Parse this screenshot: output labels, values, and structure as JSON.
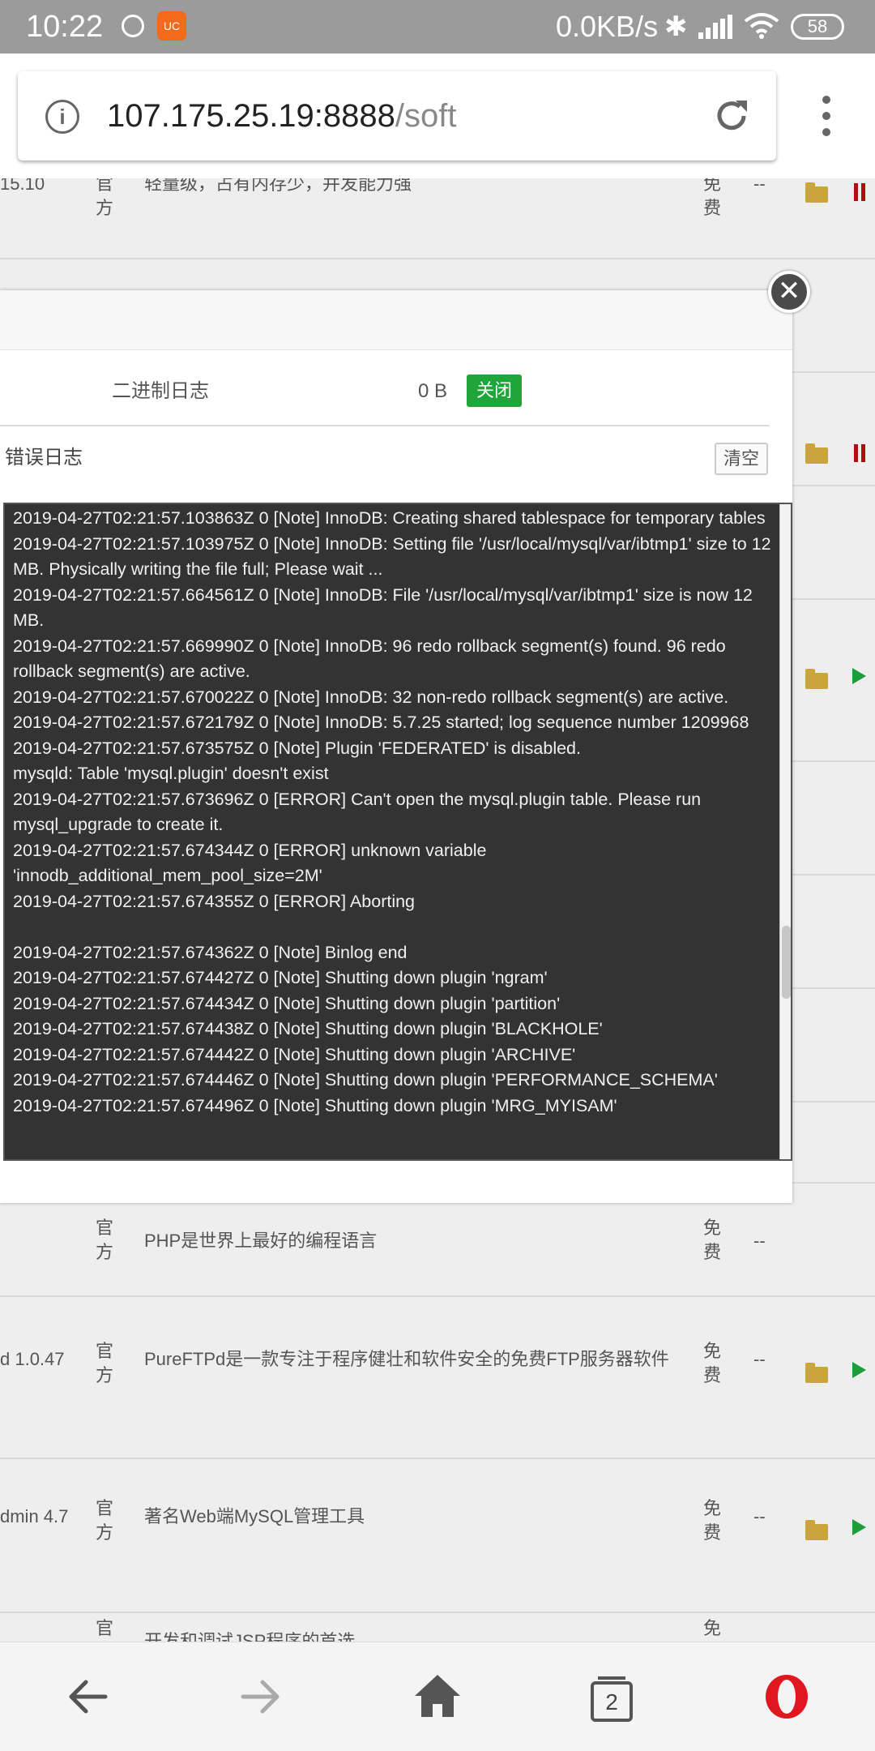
{
  "status_bar": {
    "time": "10:22",
    "net_speed": "0.0KB/s",
    "bluetooth": "✱",
    "battery": "58",
    "app_badge": "UC"
  },
  "browser": {
    "url_host": "107.175.25.19:8888",
    "url_path": "/soft"
  },
  "software_rows": [
    {
      "name": "15.10",
      "type": "官方",
      "desc": "轻量级，占有内存少，并发能力强",
      "price": "免费",
      "expire": "--",
      "status": "pause"
    },
    {
      "name": "",
      "type": "官",
      "desc": "",
      "price": "免",
      "expire": "",
      "status": "none"
    },
    {
      "name": "",
      "type": "",
      "desc": "",
      "price": "",
      "expire": "",
      "status": "pause"
    },
    {
      "name": "",
      "type": "",
      "desc": "",
      "price": "",
      "expire": "",
      "status": "play"
    },
    {
      "name": "",
      "type": "官方",
      "desc": "PHP是世界上最好的编程语言",
      "price": "免费",
      "expire": "--",
      "status": "none"
    },
    {
      "name": "d 1.0.47",
      "type": "官方",
      "desc": "PureFTPd是一款专注于程序健壮和软件安全的免费FTP服务器软件",
      "price": "免费",
      "expire": "--",
      "status": "play"
    },
    {
      "name": "dmin 4.7",
      "type": "官方",
      "desc": "著名Web端MySQL管理工具",
      "price": "免费",
      "expire": "--",
      "status": "play"
    },
    {
      "name": "",
      "type": "官方",
      "desc": "开发和调试JSP程序的首选",
      "price": "免费",
      "expire": "--",
      "status": "none"
    }
  ],
  "modal": {
    "close_glyph": "✕",
    "binlog_label": "二进制日志",
    "binlog_size": "0 B",
    "binlog_toggle": "关闭",
    "errlog_label": "错误日志",
    "clear_label": "清空",
    "log_lines": [
      "2019-04-27T02:21:57.103863Z 0 [Note] InnoDB: Creating shared tablespace for temporary tables",
      "2019-04-27T02:21:57.103975Z 0 [Note] InnoDB: Setting file '/usr/local/mysql/var/ibtmp1' size to 12 MB. Physically writing the file full; Please wait ...",
      "2019-04-27T02:21:57.664561Z 0 [Note] InnoDB: File '/usr/local/mysql/var/ibtmp1' size is now 12 MB.",
      "2019-04-27T02:21:57.669990Z 0 [Note] InnoDB: 96 redo rollback segment(s) found. 96 redo rollback segment(s) are active.",
      "2019-04-27T02:21:57.670022Z 0 [Note] InnoDB: 32 non-redo rollback segment(s) are active.",
      "2019-04-27T02:21:57.672179Z 0 [Note] InnoDB: 5.7.25 started; log sequence number 1209968",
      "2019-04-27T02:21:57.673575Z 0 [Note] Plugin 'FEDERATED' is disabled.",
      "mysqld: Table 'mysql.plugin' doesn't exist",
      "2019-04-27T02:21:57.673696Z 0 [ERROR] Can't open the mysql.plugin table. Please run mysql_upgrade to create it.",
      "2019-04-27T02:21:57.674344Z 0 [ERROR] unknown variable 'innodb_additional_mem_pool_size=2M'",
      "2019-04-27T02:21:57.674355Z 0 [ERROR] Aborting",
      "",
      "2019-04-27T02:21:57.674362Z 0 [Note] Binlog end",
      "2019-04-27T02:21:57.674427Z 0 [Note] Shutting down plugin 'ngram'",
      "2019-04-27T02:21:57.674434Z 0 [Note] Shutting down plugin 'partition'",
      "2019-04-27T02:21:57.674438Z 0 [Note] Shutting down plugin 'BLACKHOLE'",
      "2019-04-27T02:21:57.674442Z 0 [Note] Shutting down plugin 'ARCHIVE'",
      "2019-04-27T02:21:57.674446Z 0 [Note] Shutting down plugin 'PERFORMANCE_SCHEMA'",
      "2019-04-27T02:21:57.674496Z 0 [Note] Shutting down plugin 'MRG_MYISAM'"
    ]
  },
  "bottom_nav": {
    "tab_count": "2"
  },
  "colors": {
    "status_bar": "#9b9b9b",
    "toggle_green": "#20a53a",
    "log_bg": "#333333",
    "opera_red": "#e0171e",
    "play_green": "#1e9e3a",
    "pause_red": "#b10e0e",
    "folder_gold": "#c9a53b"
  },
  "icons": [
    "info-icon",
    "reload-icon",
    "more-menu-icon",
    "close-icon",
    "back-icon",
    "forward-icon",
    "home-icon",
    "tabs-icon",
    "opera-logo-icon",
    "folder-icon",
    "play-icon",
    "pause-icon"
  ]
}
